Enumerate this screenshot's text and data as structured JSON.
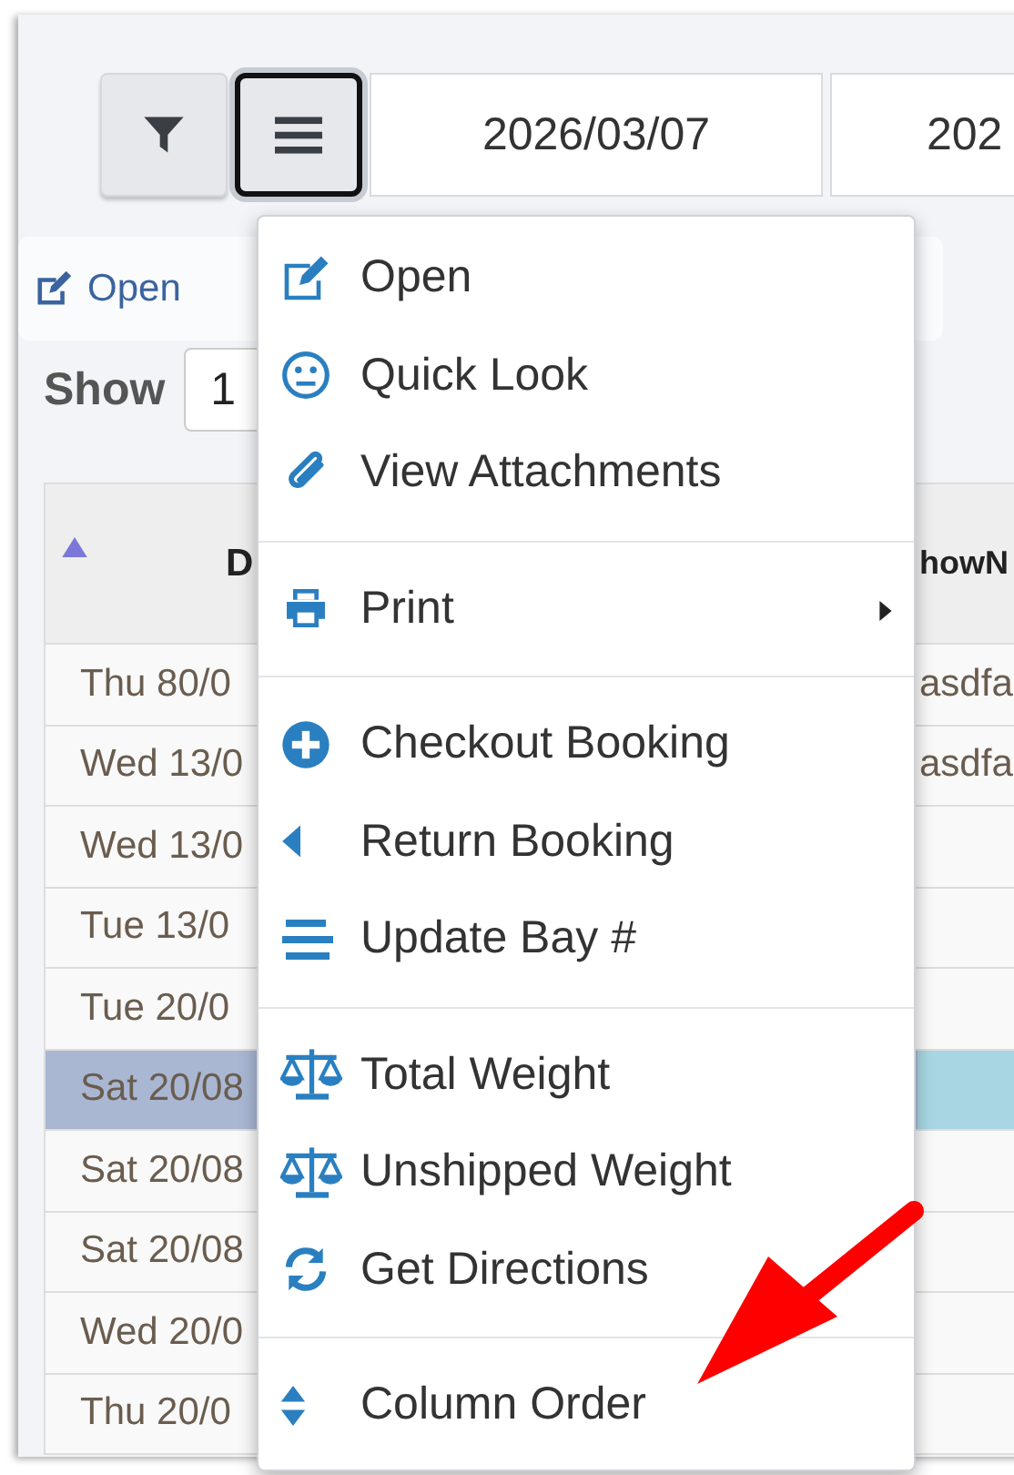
{
  "toolbar": {
    "menu_button_focused": true,
    "date_from": "2026/03/07",
    "date_to": "202"
  },
  "action_bar": {
    "open_link": "Open"
  },
  "length_control": {
    "label": "Show",
    "value": "1"
  },
  "table": {
    "columns": [
      {
        "label": "D",
        "sorted": true
      },
      {
        "label": "howN",
        "sorted": false
      }
    ],
    "rows": [
      {
        "cells": [
          "Thu 80/0",
          "asdfa"
        ],
        "selected": false
      },
      {
        "cells": [
          "Wed 13/0",
          "asdfa"
        ],
        "selected": false
      },
      {
        "cells": [
          "Wed 13/0",
          ""
        ],
        "selected": false
      },
      {
        "cells": [
          "Tue 13/0",
          ""
        ],
        "selected": false
      },
      {
        "cells": [
          "Tue 20/0",
          ""
        ],
        "selected": false
      },
      {
        "cells": [
          "Sat 20/08",
          ""
        ],
        "selected": true
      },
      {
        "cells": [
          "Sat 20/08",
          ""
        ],
        "selected": false
      },
      {
        "cells": [
          "Sat 20/08",
          ""
        ],
        "selected": false
      },
      {
        "cells": [
          "Wed 20/0",
          ""
        ],
        "selected": false
      },
      {
        "cells": [
          "Thu 20/0",
          ""
        ],
        "selected": false
      }
    ]
  },
  "menu": {
    "groups": [
      [
        {
          "label": "Open",
          "submenu": false
        },
        {
          "label": "Quick Look",
          "submenu": false
        },
        {
          "label": "View Attachments",
          "submenu": false
        }
      ],
      [
        {
          "label": "Print",
          "submenu": true
        }
      ],
      [
        {
          "label": "Checkout Booking",
          "submenu": false
        },
        {
          "label": "Return Booking",
          "submenu": false
        },
        {
          "label": "Update Bay #",
          "submenu": false
        }
      ],
      [
        {
          "label": "Total Weight",
          "submenu": false
        },
        {
          "label": "Unshipped Weight",
          "submenu": false
        },
        {
          "label": "Get Directions",
          "submenu": false
        }
      ],
      [
        {
          "label": "Column Order",
          "submenu": false
        }
      ]
    ]
  }
}
